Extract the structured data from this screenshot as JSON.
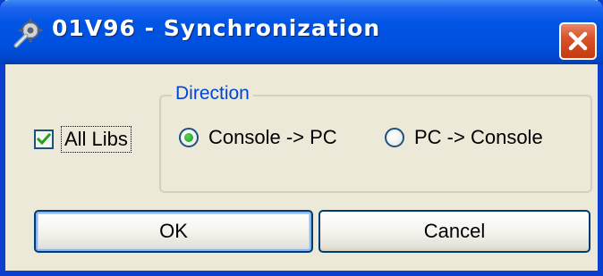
{
  "window": {
    "title": "01V96 - Synchronization",
    "app_icon": "wrench-gear-icon",
    "close_icon": "close-icon"
  },
  "options": {
    "all_libs_label": "All Libs",
    "all_libs_checked": true
  },
  "direction": {
    "group_label": "Direction",
    "options": [
      {
        "label": "Console -> PC",
        "selected": true
      },
      {
        "label": "PC -> Console",
        "selected": false
      }
    ]
  },
  "buttons": {
    "ok_label": "OK",
    "cancel_label": "Cancel"
  },
  "colors": {
    "titlebar": "#0055e5",
    "group_title": "#0046d5",
    "radio_selected": "#1a9a1a",
    "check_mark": "#21a121",
    "close_button": "#d9532a"
  }
}
